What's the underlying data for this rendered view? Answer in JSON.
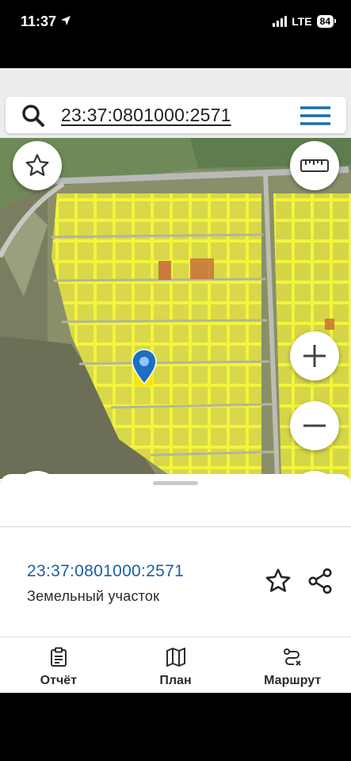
{
  "status_bar": {
    "time": "11:37",
    "network": "LTE",
    "battery": "84"
  },
  "search": {
    "query": "23:37:0801000:2571"
  },
  "plot": {
    "cadastral_number": "23:37:0801000:2571",
    "type": "Земельный участок"
  },
  "bottom_nav": [
    {
      "label": "Отчёт",
      "icon": "report-clipboard-icon"
    },
    {
      "label": "План",
      "icon": "map-icon"
    },
    {
      "label": "Маршрут",
      "icon": "route-icon"
    }
  ],
  "colors": {
    "accent": "#1a5fa6",
    "parcel": "#f2f23a",
    "selected_parcel": "#ffe600"
  }
}
